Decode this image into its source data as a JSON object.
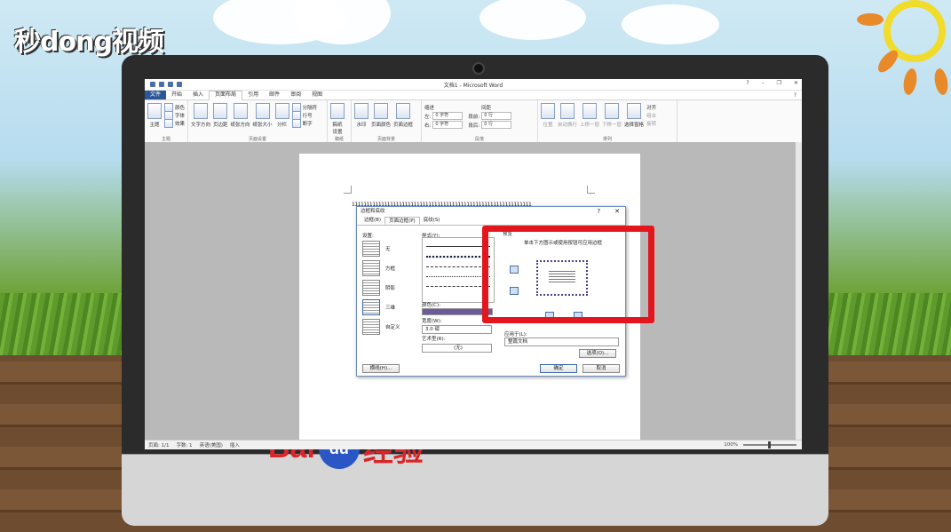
{
  "watermark": {
    "logo_text": "秒dong视频"
  },
  "brand": {
    "baidu_text_a": "Bai",
    "baidu_text_b": "du",
    "baidu_text_c": "经验"
  },
  "word": {
    "window_title": "文档1 - Microsoft Word",
    "tabs": [
      "文件",
      "开始",
      "插入",
      "页面布局",
      "引用",
      "邮件",
      "审阅",
      "视图"
    ],
    "active_tab": "页面布局",
    "ribbon": {
      "theme_group": {
        "label": "主题",
        "theme_btn": "主题",
        "colors": "颜色",
        "fonts": "字体",
        "effects": "效果"
      },
      "page_setup": {
        "label": "页面设置",
        "buttons": [
          "文字方向",
          "页边距",
          "纸张方向",
          "纸张大小",
          "分栏"
        ],
        "breaks": "分隔符",
        "line_numbers": "行号",
        "hyphenation": "断字"
      },
      "draft": {
        "label": "稿纸",
        "button": "稿纸设置"
      },
      "page_background": {
        "label": "页面背景",
        "buttons": [
          "水印",
          "页面颜色",
          "页面边框"
        ]
      },
      "paragraph": {
        "label": "段落",
        "indent_header": "缩进",
        "spacing_header": "间距",
        "left_label": "左:",
        "left_value": "0 字符",
        "right_label": "右:",
        "right_value": "0 字符",
        "before_label": "段前:",
        "before_value": "0 行",
        "after_label": "段后:",
        "after_value": "0 行"
      },
      "arrange": {
        "label": "排列",
        "buttons": [
          "位置",
          "自动换行",
          "上移一层",
          "下移一层",
          "选择窗格"
        ],
        "align": "对齐",
        "group": "组合",
        "rotate": "旋转"
      }
    },
    "document": {
      "text": "1111111111111111111111111111111111111111111111111111111111111"
    },
    "status": {
      "page": "页面: 1/1",
      "words": "字数: 1",
      "language": "英语(美国)",
      "mode": "插入",
      "zoom": "100%"
    }
  },
  "dialog": {
    "title": "边框和底纹",
    "help": "?",
    "close": "✕",
    "tabs": [
      "边框(B)",
      "页面边框(P)",
      "底纹(S)"
    ],
    "active_tab": 1,
    "settings_label": "设置:",
    "settings": [
      "无",
      "方框",
      "阴影",
      "三维",
      "自定义"
    ],
    "selected_setting": 3,
    "style_label": "样式(Y):",
    "color_label": "颜色(C):",
    "width_label": "宽度(W):",
    "width_value": "3.0 磅",
    "art_label": "艺术型(R):",
    "art_value": "(无)",
    "preview_label": "预览",
    "preview_hint": "单击下方图示或使用按钮可应用边框",
    "apply_to_label": "应用于(L):",
    "apply_to_value": "整篇文档",
    "options_btn": "选项(O)...",
    "hline_btn": "横线(H)...",
    "ok_btn": "确定",
    "cancel_btn": "取消"
  },
  "colors": {
    "accent_word": "#2b579a",
    "highlight": "#e2161c",
    "border_color": "#6c5a9a"
  }
}
